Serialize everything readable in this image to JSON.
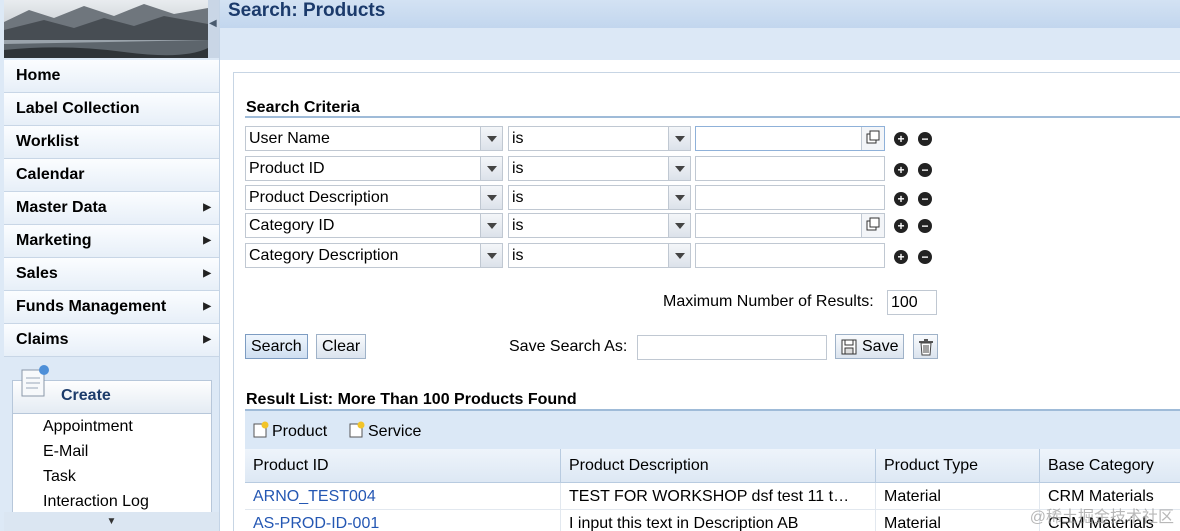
{
  "nav": {
    "items": [
      {
        "label": "Home",
        "submenu": false
      },
      {
        "label": "Label Collection",
        "submenu": false
      },
      {
        "label": "Worklist",
        "submenu": false
      },
      {
        "label": "Calendar",
        "submenu": false
      },
      {
        "label": "Master Data",
        "submenu": true
      },
      {
        "label": "Marketing",
        "submenu": true
      },
      {
        "label": "Sales",
        "submenu": true
      },
      {
        "label": "Funds Management",
        "submenu": true
      },
      {
        "label": "Claims",
        "submenu": true
      }
    ],
    "create": {
      "title": "Create",
      "items": [
        "Appointment",
        "E-Mail",
        "Task",
        "Interaction Log"
      ]
    }
  },
  "header": {
    "title": "Search: Products"
  },
  "criteria": {
    "title": "Search Criteria",
    "rows": [
      {
        "field": "User Name",
        "operator": "is",
        "value": ""
      },
      {
        "field": "Product ID",
        "operator": "is",
        "value": ""
      },
      {
        "field": "Product Description",
        "operator": "is",
        "value": ""
      },
      {
        "field": "Category ID",
        "operator": "is",
        "value": ""
      },
      {
        "field": "Category Description",
        "operator": "is",
        "value": ""
      }
    ],
    "max_results_label": "Maximum Number of Results:",
    "max_results_value": "100",
    "search_button": "Search",
    "clear_button": "Clear",
    "save_search_label": "Save Search As:",
    "save_search_value": "",
    "save_button": "Save"
  },
  "results": {
    "title": "Result List: More Than 100 Products Found",
    "toolbar": [
      "Product",
      "Service"
    ],
    "columns": [
      "Product ID",
      "Product Description",
      "Product Type",
      "Base Category"
    ],
    "rows": [
      [
        "ARNO_TEST004",
        "TEST FOR WORKSHOP dsf test 11 t…",
        "Material",
        "CRM Materials"
      ],
      [
        "AS-PROD-ID-001",
        "I input this text in Description AB",
        "Material",
        "CRM Materials"
      ]
    ]
  },
  "watermark": "@稀土掘金技术社区",
  "colors": {
    "accent": "#1b3a6b",
    "link": "#2457b3",
    "nav_bg": "#dde9f6",
    "toolbar_bg": "#dbe8f6"
  }
}
